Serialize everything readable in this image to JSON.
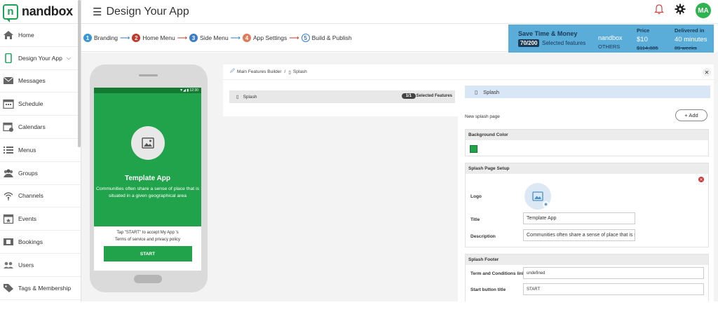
{
  "app": {
    "brand": "nandbox",
    "page_title": "Design Your App",
    "avatar_initials": "MA"
  },
  "sidebar": {
    "items": [
      {
        "label": "Home",
        "icon": "home-icon"
      },
      {
        "label": "Design Your App",
        "icon": "phone-icon"
      },
      {
        "label": "Messages",
        "icon": "envelope-icon"
      },
      {
        "label": "Schedule",
        "icon": "schedule-icon"
      },
      {
        "label": "Calendars",
        "icon": "calendar-icon"
      },
      {
        "label": "Menus",
        "icon": "list-icon"
      },
      {
        "label": "Groups",
        "icon": "group-icon"
      },
      {
        "label": "Channels",
        "icon": "broadcast-icon"
      },
      {
        "label": "Events",
        "icon": "event-icon"
      },
      {
        "label": "Bookings",
        "icon": "booking-icon"
      },
      {
        "label": "Users",
        "icon": "users-icon"
      },
      {
        "label": "Tags & Membership",
        "icon": "tag-icon"
      }
    ]
  },
  "steps": [
    {
      "num": "1",
      "label": "Branding",
      "color": "#3a97d4"
    },
    {
      "num": "2",
      "label": "Home Menu",
      "color": "#c0392b"
    },
    {
      "num": "3",
      "label": "Side Menu",
      "color": "#3a7cc9"
    },
    {
      "num": "4",
      "label": "App Settings",
      "color": "#e07b5a"
    },
    {
      "num": "5",
      "label": "Build & Publish",
      "color": "#ffffff"
    }
  ],
  "promo": {
    "title": "Save Time & Money",
    "badge": "70/200",
    "selected": "Selected features",
    "brand": "nandbox",
    "others": "OTHERS",
    "price_header": "Price",
    "price_value": "$10",
    "price_old": "$114,885",
    "delivered_header": "Delivered in",
    "delivered_value": "40 minutes",
    "delivered_old": "89 weeks"
  },
  "phone": {
    "time": "12:30",
    "title": "Template App",
    "description": "Communities often share a sense of place that is situated in a given geographical area",
    "terms_line1": "Tap \"START\" to accept My App 's",
    "terms_line2": "Terms of service and privacy policy",
    "start": "START"
  },
  "builder": {
    "crumb_root": "Main Features Builder",
    "crumb_sep": "/",
    "crumb_current": "Splash",
    "feature_label": "Splash",
    "feature_count": "1/1",
    "feature_selected": "Selected Features",
    "settings_title": "Splash",
    "new_splash": "New splash page",
    "add": "+ Add",
    "bg_section": "Background Color",
    "bg_color": "#20a34a",
    "setup_section": "Splash Page Setup",
    "logo_label": "Logo",
    "title_label": "Title",
    "title_value": "Template App",
    "desc_label": "Description",
    "desc_value": "Communities often share a sense of place that is situated in a given geographical area",
    "footer_section": "Splash Footer",
    "terms_label": "Term and Conditions link",
    "terms_value": "undefined",
    "start_label": "Start button title",
    "start_value": "START"
  }
}
